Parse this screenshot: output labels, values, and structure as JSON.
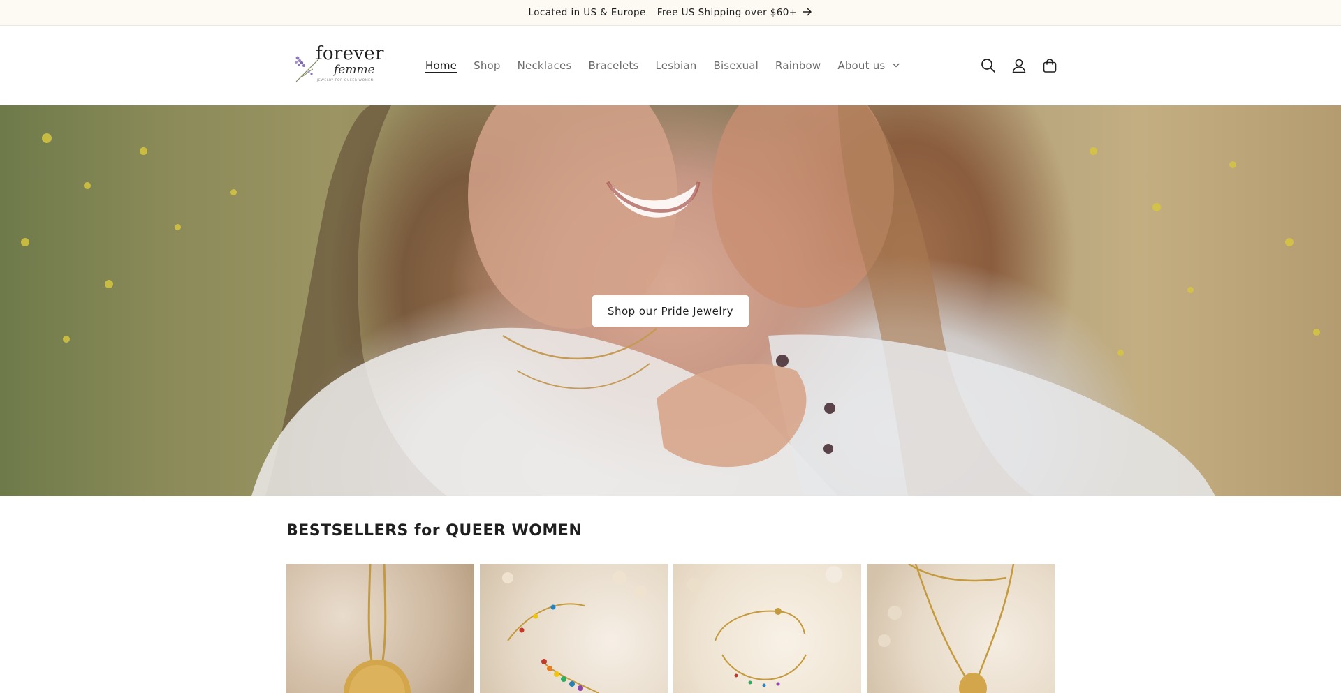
{
  "announcement": {
    "location": "Located in US & Europe",
    "shipping": "Free US Shipping over $60+",
    "arrow_icon": "arrow-right-icon"
  },
  "header": {
    "logo": {
      "line1": "forever",
      "line2": "femme",
      "tagline": "JEWELRY FOR QUEER WOMEN"
    },
    "nav": [
      {
        "label": "Home",
        "active": true
      },
      {
        "label": "Shop"
      },
      {
        "label": "Necklaces"
      },
      {
        "label": "Bracelets"
      },
      {
        "label": "Lesbian"
      },
      {
        "label": "Bisexual"
      },
      {
        "label": "Rainbow"
      },
      {
        "label": "About us",
        "has_dropdown": true
      }
    ],
    "icons": [
      "search-icon",
      "account-icon",
      "cart-icon"
    ]
  },
  "hero": {
    "button_label": "Shop our Pride Jewelry"
  },
  "bestsellers": {
    "title": "BESTSELLERS for QUEER WOMEN",
    "products": [
      {
        "image": "gold-coin-pendant-necklace"
      },
      {
        "image": "rainbow-enamel-bracelet"
      },
      {
        "image": "gold-beaded-bracelet"
      },
      {
        "image": "layered-gold-necklace"
      }
    ]
  },
  "colors": {
    "announcement_bg": "#fdf9f3",
    "text": "#1f1f1f",
    "nav_muted": "#6b6b6b",
    "button_bg": "#ffffff"
  }
}
